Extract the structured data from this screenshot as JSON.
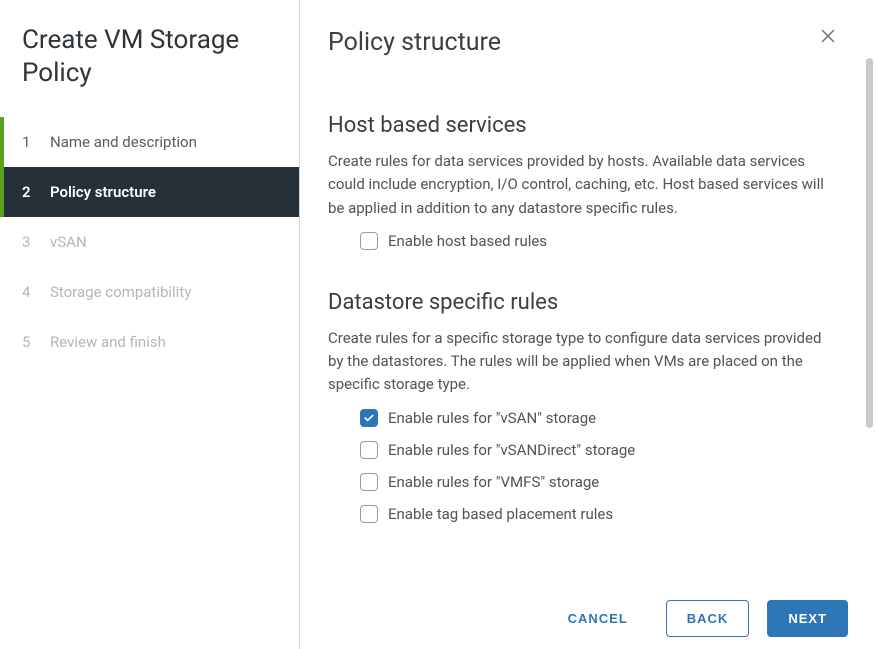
{
  "wizard_title": "Create VM Storage Policy",
  "steps": [
    {
      "num": "1",
      "label": "Name and description",
      "state": "completed"
    },
    {
      "num": "2",
      "label": "Policy structure",
      "state": "active"
    },
    {
      "num": "3",
      "label": "vSAN",
      "state": "disabled"
    },
    {
      "num": "4",
      "label": "Storage compatibility",
      "state": "disabled"
    },
    {
      "num": "5",
      "label": "Review and finish",
      "state": "disabled"
    }
  ],
  "page_title": "Policy structure",
  "host_section": {
    "title": "Host based services",
    "desc": "Create rules for data services provided by hosts. Available data services could include encryption, I/O control, caching, etc. Host based services will be applied in addition to any datastore specific rules.",
    "checkbox_label": "Enable host based rules",
    "checked": false
  },
  "datastore_section": {
    "title": "Datastore specific rules",
    "desc": "Create rules for a specific storage type to configure data services provided by the datastores. The rules will be applied when VMs are placed on the specific storage type.",
    "options": [
      {
        "label": "Enable rules for \"vSAN\" storage",
        "checked": true
      },
      {
        "label": "Enable rules for \"vSANDirect\" storage",
        "checked": false
      },
      {
        "label": "Enable rules for \"VMFS\" storage",
        "checked": false
      },
      {
        "label": "Enable tag based placement rules",
        "checked": false
      }
    ]
  },
  "buttons": {
    "cancel": "CANCEL",
    "back": "BACK",
    "next": "NEXT"
  }
}
